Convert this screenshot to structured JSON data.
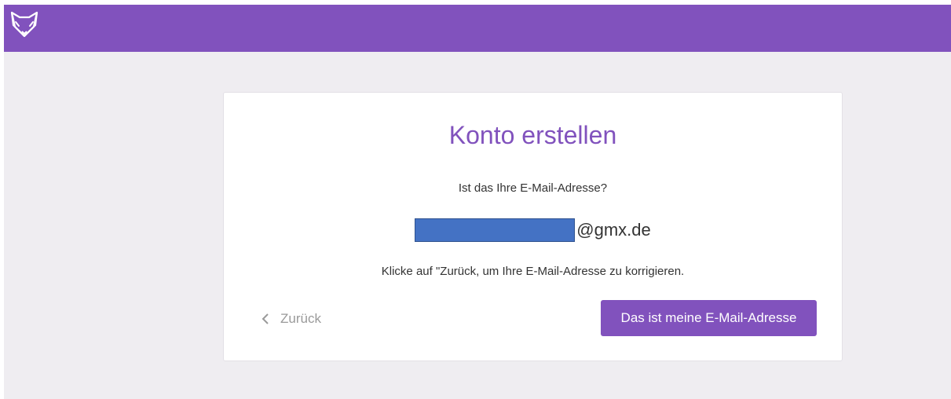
{
  "header": {
    "logo_icon": "fox-icon",
    "background": "#8152bd"
  },
  "card": {
    "title": "Konto erstellen",
    "question": "Ist das Ihre E-Mail-Adresse?",
    "email_domain": "@gmx.de",
    "hint": "Klicke auf \"Zurück, um Ihre E-Mail-Adresse zu korrigieren.",
    "back_label": "Zurück",
    "back_icon": "chevron-left-icon",
    "confirm_label": "Das ist meine E-Mail-Adresse"
  },
  "colors": {
    "accent": "#8152bd",
    "page_background": "#efedf1",
    "redaction": "#4472c4"
  }
}
